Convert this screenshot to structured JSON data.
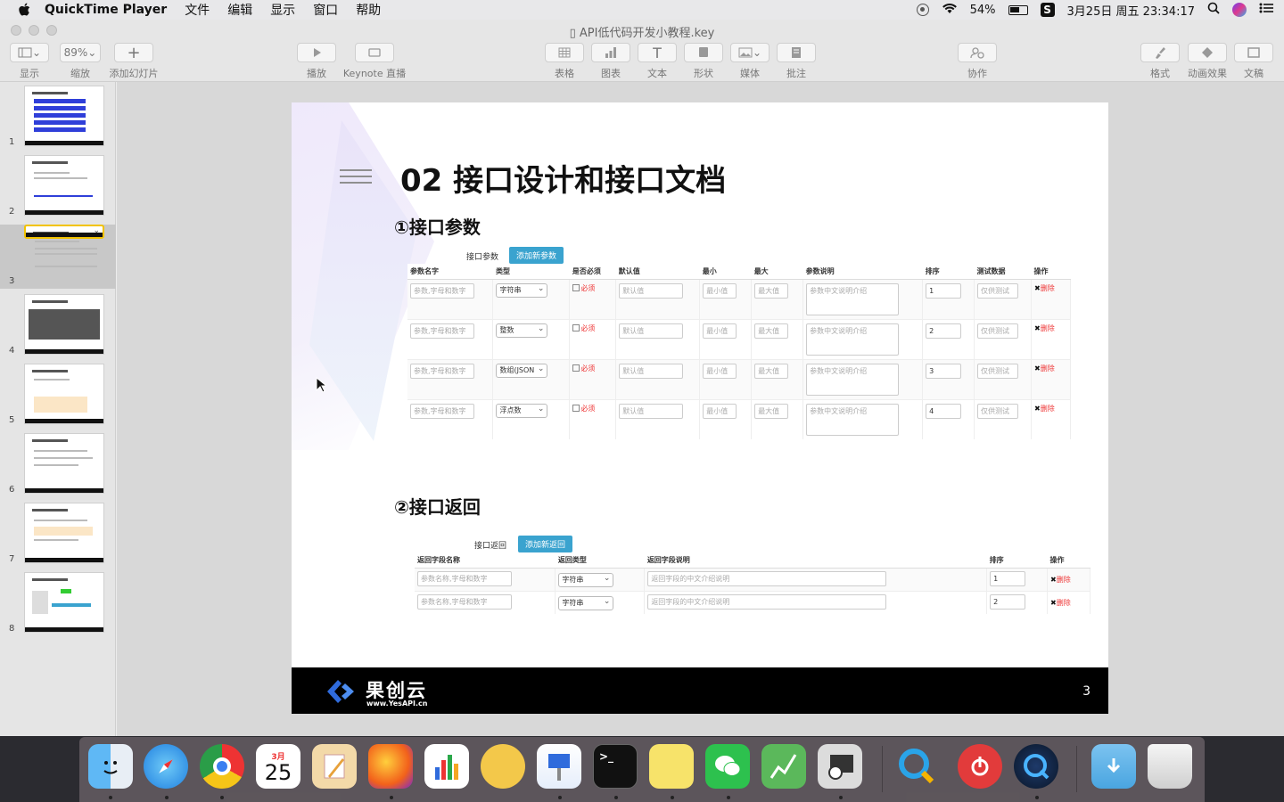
{
  "menubar": {
    "app": "QuickTime Player",
    "items": [
      "文件",
      "编辑",
      "显示",
      "窗口",
      "帮助"
    ],
    "battery": "54%",
    "datetime": "3月25日 周五 23:34:17"
  },
  "window": {
    "title": "API低代码开发小教程.key",
    "toolbar": {
      "view": "显示",
      "zoom_value": "89%",
      "zoom": "缩放",
      "add_slide": "添加幻灯片",
      "play": "播放",
      "keynote_live": "Keynote 直播",
      "table": "表格",
      "chart": "图表",
      "text": "文本",
      "shape": "形状",
      "media": "媒体",
      "comment": "批注",
      "collaborate": "协作",
      "format": "格式",
      "animate": "动画效果",
      "document": "文稿"
    }
  },
  "sidebar": {
    "slides": [
      "1",
      "2",
      "3",
      "4",
      "5",
      "6",
      "7",
      "8"
    ],
    "selected": "3"
  },
  "slide": {
    "title": "02 接口设计和接口文档",
    "section1": "①接口参数",
    "section2": "②接口返回",
    "params": {
      "label": "接口参数",
      "add_button": "添加新参数",
      "headers": [
        "参数名字",
        "类型",
        "是否必须",
        "默认值",
        "最小",
        "最大",
        "参数说明",
        "排序",
        "测试数据",
        "操作"
      ],
      "name_placeholder": "参数,字母和数字",
      "required": "必须",
      "default_placeholder": "默认值",
      "min_placeholder": "最小值",
      "max_placeholder": "最大值",
      "desc_placeholder": "参数中文说明介绍",
      "test_placeholder": "仅供测试",
      "delete": "删除",
      "rows": [
        {
          "type": "字符串",
          "order": "1"
        },
        {
          "type": "整数",
          "order": "2"
        },
        {
          "type": "数组(JSON",
          "order": "3"
        },
        {
          "type": "浮点数",
          "order": "4"
        }
      ]
    },
    "returns": {
      "label": "接口返回",
      "add_button": "添加新返回",
      "headers": [
        "返回字段名称",
        "返回类型",
        "返回字段说明",
        "排序",
        "操作"
      ],
      "name_placeholder": "参数名称,字母和数字",
      "desc_placeholder": "返回字段的中文介绍说明",
      "delete": "删除",
      "rows": [
        {
          "type": "字符串",
          "order": "1"
        },
        {
          "type": "字符串",
          "order": "2"
        }
      ]
    },
    "footer": {
      "brand": "果创云",
      "url": "www.YesAPI.cn",
      "page": "3"
    }
  },
  "dock": {
    "calendar_month": "3月",
    "calendar_day": "25"
  }
}
